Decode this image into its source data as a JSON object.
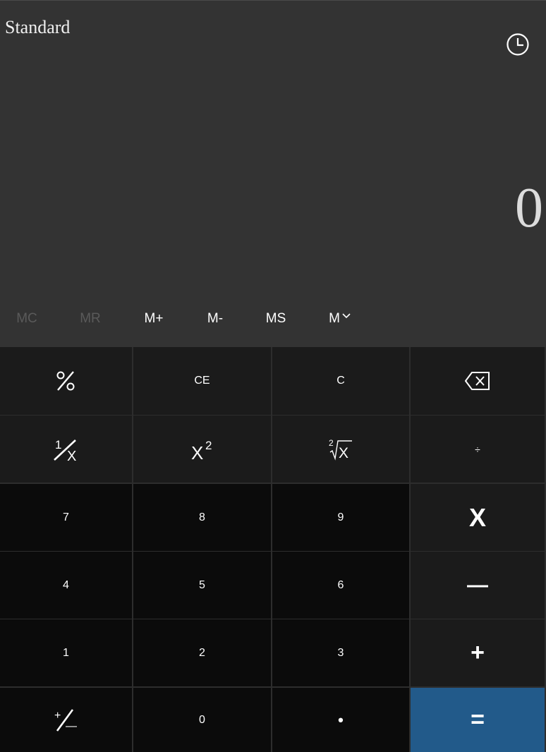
{
  "header": {
    "mode_title": "Standard"
  },
  "display": {
    "value": "0"
  },
  "memory": {
    "mc": "MC",
    "mr": "MR",
    "m_plus": "M+",
    "m_minus": "M-",
    "ms": "MS",
    "m_list": "M"
  },
  "keys": {
    "percent": "%",
    "ce": "CE",
    "c": "C",
    "divide": "÷",
    "seven": "7",
    "eight": "8",
    "nine": "9",
    "four": "4",
    "five": "5",
    "six": "6",
    "one": "1",
    "two": "2",
    "three": "3",
    "zero": "0",
    "decimal": "•",
    "multiply": "X",
    "subtract": "—",
    "add": "+",
    "equals": "=",
    "reciprocal_num": "1",
    "reciprocal_den": "X",
    "square_base": "X",
    "square_exp": "2",
    "sqrt_index": "2",
    "sqrt_radicand": "X",
    "negate_plus": "+",
    "negate_minus": "—"
  },
  "colors": {
    "display_bg": "#333333",
    "function_key_bg": "#1b1b1b",
    "digit_key_bg": "#0b0b0b",
    "equals_bg": "#225a8a",
    "text": "#ffffff",
    "disabled_text": "#5a5a5a"
  },
  "icons": {
    "history": "history-clock-icon",
    "backspace": "backspace-icon",
    "memory_dropdown": "chevron-down-icon"
  }
}
